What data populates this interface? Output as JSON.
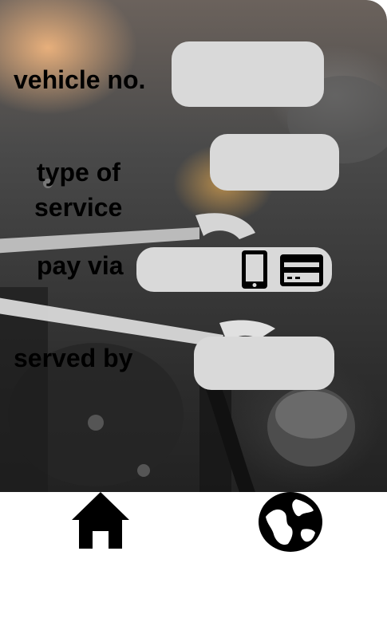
{
  "form": {
    "vehicle_label": "vehicle no.",
    "service_label_line1": "type of",
    "service_label_line2": "service",
    "pay_label": "pay via",
    "served_label": "served by",
    "vehicle_value": "",
    "service_value": "",
    "served_value": ""
  },
  "icons": {
    "pay_options": [
      "mobile-phone-icon",
      "credit-card-icon"
    ],
    "nav": [
      "home-icon",
      "globe-icon"
    ]
  },
  "colors": {
    "field": "#d9d9d9",
    "text": "#000000",
    "nav_bg": "#ffffff"
  }
}
